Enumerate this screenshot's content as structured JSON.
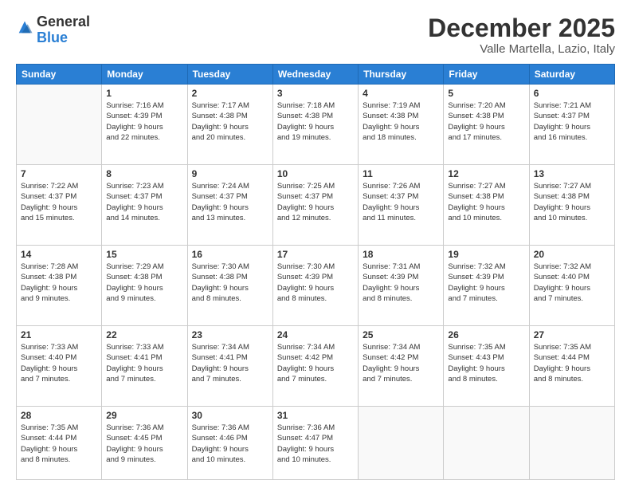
{
  "logo": {
    "general": "General",
    "blue": "Blue"
  },
  "header": {
    "month": "December 2025",
    "location": "Valle Martella, Lazio, Italy"
  },
  "weekdays": [
    "Sunday",
    "Monday",
    "Tuesday",
    "Wednesday",
    "Thursday",
    "Friday",
    "Saturday"
  ],
  "weeks": [
    [
      {
        "day": "",
        "info": ""
      },
      {
        "day": "1",
        "info": "Sunrise: 7:16 AM\nSunset: 4:39 PM\nDaylight: 9 hours\nand 22 minutes."
      },
      {
        "day": "2",
        "info": "Sunrise: 7:17 AM\nSunset: 4:38 PM\nDaylight: 9 hours\nand 20 minutes."
      },
      {
        "day": "3",
        "info": "Sunrise: 7:18 AM\nSunset: 4:38 PM\nDaylight: 9 hours\nand 19 minutes."
      },
      {
        "day": "4",
        "info": "Sunrise: 7:19 AM\nSunset: 4:38 PM\nDaylight: 9 hours\nand 18 minutes."
      },
      {
        "day": "5",
        "info": "Sunrise: 7:20 AM\nSunset: 4:38 PM\nDaylight: 9 hours\nand 17 minutes."
      },
      {
        "day": "6",
        "info": "Sunrise: 7:21 AM\nSunset: 4:37 PM\nDaylight: 9 hours\nand 16 minutes."
      }
    ],
    [
      {
        "day": "7",
        "info": "Sunrise: 7:22 AM\nSunset: 4:37 PM\nDaylight: 9 hours\nand 15 minutes."
      },
      {
        "day": "8",
        "info": "Sunrise: 7:23 AM\nSunset: 4:37 PM\nDaylight: 9 hours\nand 14 minutes."
      },
      {
        "day": "9",
        "info": "Sunrise: 7:24 AM\nSunset: 4:37 PM\nDaylight: 9 hours\nand 13 minutes."
      },
      {
        "day": "10",
        "info": "Sunrise: 7:25 AM\nSunset: 4:37 PM\nDaylight: 9 hours\nand 12 minutes."
      },
      {
        "day": "11",
        "info": "Sunrise: 7:26 AM\nSunset: 4:37 PM\nDaylight: 9 hours\nand 11 minutes."
      },
      {
        "day": "12",
        "info": "Sunrise: 7:27 AM\nSunset: 4:38 PM\nDaylight: 9 hours\nand 10 minutes."
      },
      {
        "day": "13",
        "info": "Sunrise: 7:27 AM\nSunset: 4:38 PM\nDaylight: 9 hours\nand 10 minutes."
      }
    ],
    [
      {
        "day": "14",
        "info": "Sunrise: 7:28 AM\nSunset: 4:38 PM\nDaylight: 9 hours\nand 9 minutes."
      },
      {
        "day": "15",
        "info": "Sunrise: 7:29 AM\nSunset: 4:38 PM\nDaylight: 9 hours\nand 9 minutes."
      },
      {
        "day": "16",
        "info": "Sunrise: 7:30 AM\nSunset: 4:38 PM\nDaylight: 9 hours\nand 8 minutes."
      },
      {
        "day": "17",
        "info": "Sunrise: 7:30 AM\nSunset: 4:39 PM\nDaylight: 9 hours\nand 8 minutes."
      },
      {
        "day": "18",
        "info": "Sunrise: 7:31 AM\nSunset: 4:39 PM\nDaylight: 9 hours\nand 8 minutes."
      },
      {
        "day": "19",
        "info": "Sunrise: 7:32 AM\nSunset: 4:39 PM\nDaylight: 9 hours\nand 7 minutes."
      },
      {
        "day": "20",
        "info": "Sunrise: 7:32 AM\nSunset: 4:40 PM\nDaylight: 9 hours\nand 7 minutes."
      }
    ],
    [
      {
        "day": "21",
        "info": "Sunrise: 7:33 AM\nSunset: 4:40 PM\nDaylight: 9 hours\nand 7 minutes."
      },
      {
        "day": "22",
        "info": "Sunrise: 7:33 AM\nSunset: 4:41 PM\nDaylight: 9 hours\nand 7 minutes."
      },
      {
        "day": "23",
        "info": "Sunrise: 7:34 AM\nSunset: 4:41 PM\nDaylight: 9 hours\nand 7 minutes."
      },
      {
        "day": "24",
        "info": "Sunrise: 7:34 AM\nSunset: 4:42 PM\nDaylight: 9 hours\nand 7 minutes."
      },
      {
        "day": "25",
        "info": "Sunrise: 7:34 AM\nSunset: 4:42 PM\nDaylight: 9 hours\nand 7 minutes."
      },
      {
        "day": "26",
        "info": "Sunrise: 7:35 AM\nSunset: 4:43 PM\nDaylight: 9 hours\nand 8 minutes."
      },
      {
        "day": "27",
        "info": "Sunrise: 7:35 AM\nSunset: 4:44 PM\nDaylight: 9 hours\nand 8 minutes."
      }
    ],
    [
      {
        "day": "28",
        "info": "Sunrise: 7:35 AM\nSunset: 4:44 PM\nDaylight: 9 hours\nand 8 minutes."
      },
      {
        "day": "29",
        "info": "Sunrise: 7:36 AM\nSunset: 4:45 PM\nDaylight: 9 hours\nand 9 minutes."
      },
      {
        "day": "30",
        "info": "Sunrise: 7:36 AM\nSunset: 4:46 PM\nDaylight: 9 hours\nand 10 minutes."
      },
      {
        "day": "31",
        "info": "Sunrise: 7:36 AM\nSunset: 4:47 PM\nDaylight: 9 hours\nand 10 minutes."
      },
      {
        "day": "",
        "info": ""
      },
      {
        "day": "",
        "info": ""
      },
      {
        "day": "",
        "info": ""
      }
    ]
  ]
}
